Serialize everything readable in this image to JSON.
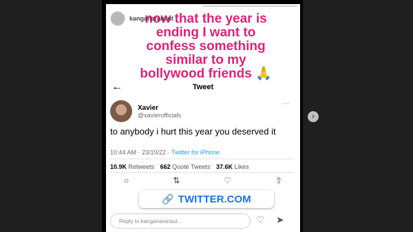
{
  "story": {
    "username": "kanganaranaut",
    "progress": 0.5,
    "caption_lines": [
      "now that the year is",
      "ending I want to",
      "confess something",
      "similar to my",
      "bollywood friends 🙏"
    ],
    "reply_placeholder": "Reply to kanganaranaut...",
    "link_label": "TWITTER.COM"
  },
  "tweet": {
    "header_title": "Tweet",
    "author_name": "Xavier",
    "author_handle": "@xavierofficials",
    "text": "to anybody i hurt this year you deserved it",
    "time": "10:44 AM · 23/10/22 ·",
    "source": "Twitter for iPhone",
    "retweets": "10.9K",
    "retweets_label": "Retweets",
    "quotes": "662",
    "quotes_label": "Quote Tweets",
    "likes": "37.6K",
    "likes_label": "Likes"
  },
  "icons": {
    "back": "arrow-left-icon",
    "more": "more-icon",
    "reply": "reply-icon",
    "retweet": "retweet-icon",
    "like": "heart-icon",
    "share": "share-icon",
    "link": "link-icon",
    "send": "send-icon",
    "next": "chevron-right-icon"
  }
}
